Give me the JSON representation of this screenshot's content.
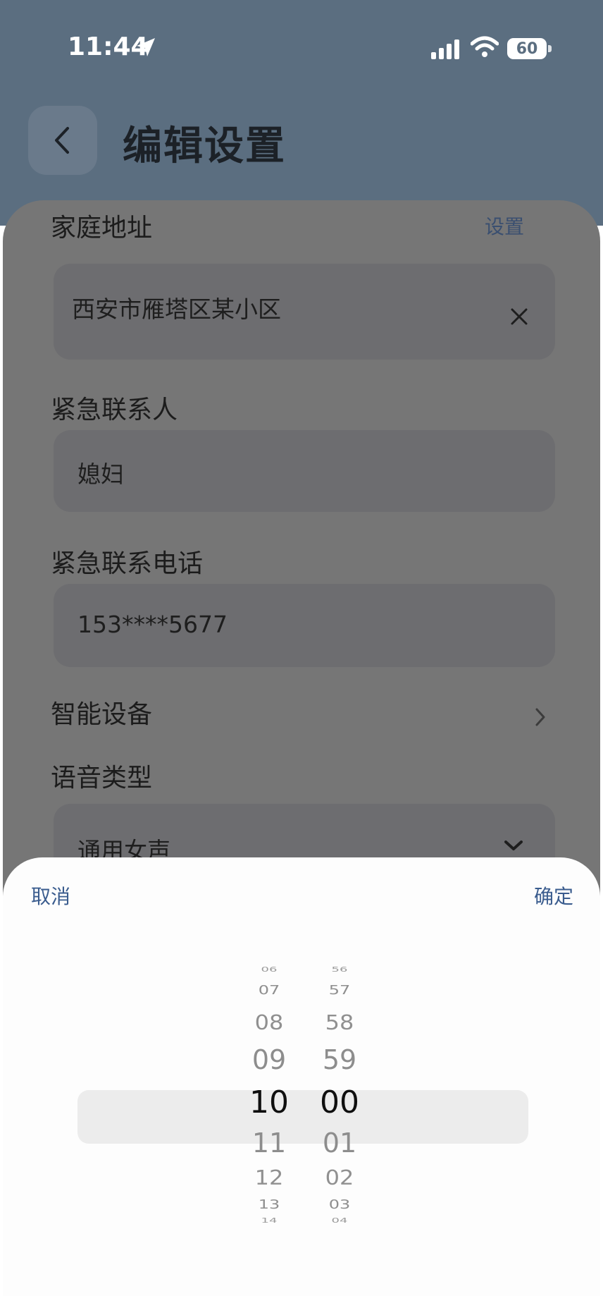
{
  "status_bar": {
    "time": "11:44",
    "battery": "60",
    "icons": [
      "location-arrow-icon",
      "signal-icon",
      "wifi-icon",
      "battery-icon"
    ]
  },
  "header": {
    "title": "编辑设置",
    "back_icon": "chevron-left-icon"
  },
  "form": {
    "home_address": {
      "label": "家庭地址",
      "action": "设置",
      "value": "西安市雁塔区某小区",
      "clear_icon": "close-icon"
    },
    "emergency_contact": {
      "label": "紧急联系人",
      "value": "媳妇"
    },
    "emergency_phone": {
      "label": "紧急联系电话",
      "value": "153****5677"
    },
    "smart_device": {
      "label": "智能设备",
      "icon": "chevron-right-icon"
    },
    "voice_type": {
      "label": "语音类型",
      "value": "通用女声",
      "icon": "chevron-down-icon"
    }
  },
  "picker": {
    "cancel": "取消",
    "confirm": "确定",
    "hours": [
      "06",
      "07",
      "08",
      "09",
      "10",
      "11",
      "12",
      "13",
      "14"
    ],
    "minutes": [
      "56",
      "57",
      "58",
      "59",
      "00",
      "01",
      "02",
      "03",
      "04"
    ],
    "selected_hour": "10",
    "selected_minute": "00"
  },
  "colors": {
    "header_bg": "#5b6e80",
    "overlay_card": "#767676",
    "accent": "#3a5c8e"
  }
}
